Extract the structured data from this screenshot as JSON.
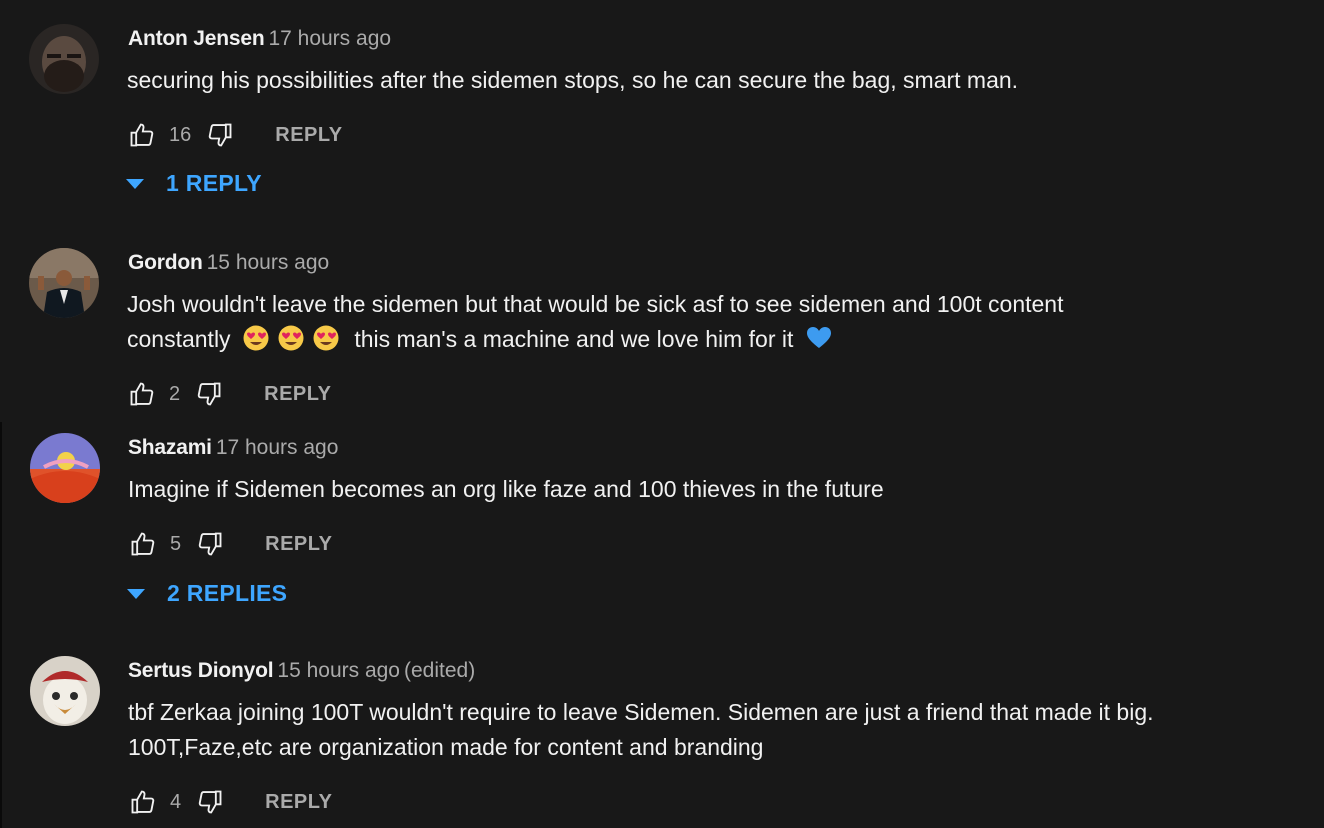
{
  "comments": [
    {
      "author": "Anton Jensen",
      "time": "17 hours ago",
      "edited": "",
      "lines": [
        "securing his possibilities after the sidemen stops, so he can secure the bag, smart man."
      ],
      "likes": "16",
      "reply_label": "REPLY",
      "replies_label": "1 REPLY"
    },
    {
      "author": "Gordon",
      "time": "15 hours ago",
      "edited": "",
      "lines": [
        "Josh wouldn't leave the sidemen but that would be sick asf to see sidemen and 100t content",
        "this man's a machine and we love him for it"
      ],
      "line2_prefix": "constantly",
      "likes": "2",
      "reply_label": "REPLY"
    },
    {
      "author": "Shazami",
      "time": "17 hours ago",
      "edited": "",
      "lines": [
        "Imagine if Sidemen becomes an org like faze and 100 thieves in the future"
      ],
      "likes": "5",
      "reply_label": "REPLY",
      "replies_label": "2 REPLIES"
    },
    {
      "author": "Sertus Dionyol",
      "time": "15 hours ago",
      "edited": "(edited)",
      "lines": [
        "tbf Zerkaa joining 100T wouldn't require to leave Sidemen. Sidemen are just a friend that made it big.",
        "100T,Faze,etc are organization made for content and branding"
      ],
      "likes": "4",
      "reply_label": "REPLY"
    }
  ],
  "colors": {
    "background": "#181818",
    "text": "#f1f1f1",
    "secondary": "#aaaaaa",
    "link": "#3ea6ff"
  },
  "icons": [
    "thumb-up-icon",
    "thumb-down-icon",
    "caret-down-icon",
    "heart-eyes-emoji",
    "blue-heart-emoji"
  ]
}
